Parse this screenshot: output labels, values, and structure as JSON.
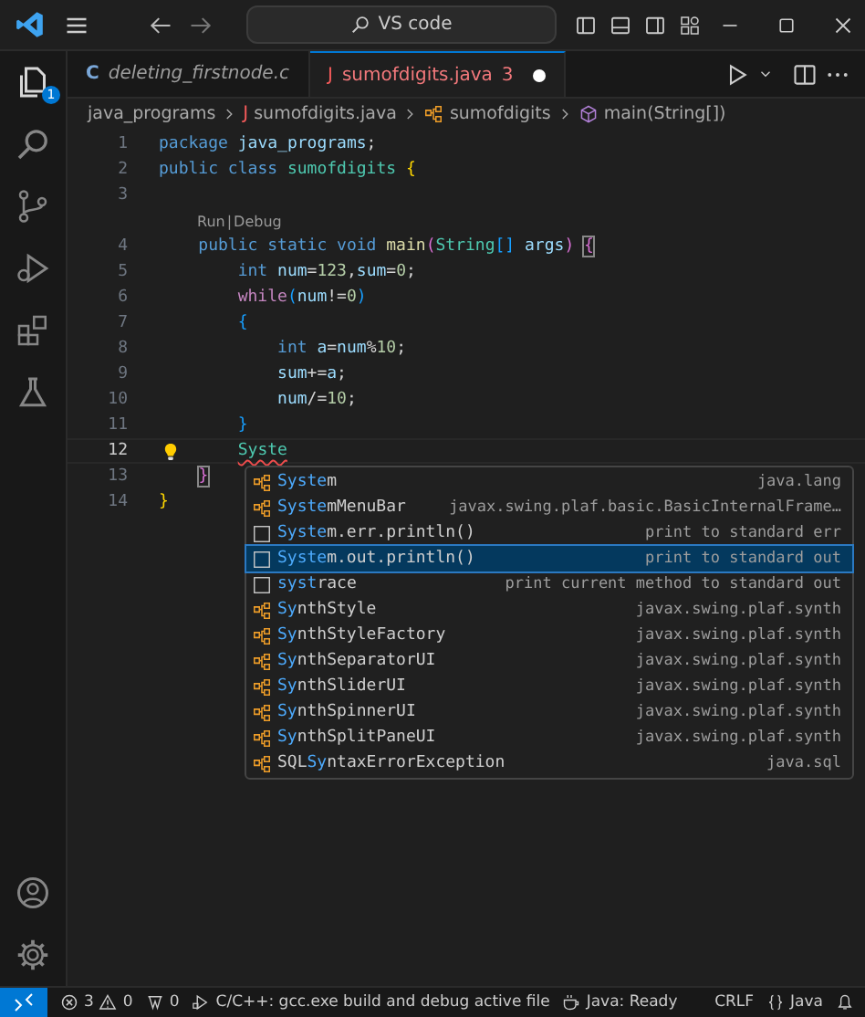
{
  "title_bar": {
    "search": "VS code"
  },
  "activity_bar": {
    "items": [
      {
        "kind": "explorer",
        "selected": true,
        "badge": "1"
      },
      {
        "kind": "search",
        "selected": false
      },
      {
        "kind": "source-control",
        "selected": false
      },
      {
        "kind": "run-debug",
        "selected": false
      },
      {
        "kind": "extensions",
        "selected": false
      },
      {
        "kind": "testing",
        "selected": false
      }
    ],
    "bottom": [
      {
        "kind": "account"
      },
      {
        "kind": "settings"
      }
    ]
  },
  "tabs": [
    {
      "kind": "c",
      "icon": "C",
      "label": "deleting_firstnode.c",
      "selected": false,
      "italic": true
    },
    {
      "kind": "java",
      "icon": "J",
      "label": "sumofdigits.java",
      "problems": "3",
      "dirty": true,
      "selected": true,
      "italic": false
    }
  ],
  "breadcrumb": [
    {
      "kind": "folder",
      "label": "java_programs"
    },
    {
      "kind": "java-file",
      "icon": "J",
      "label": "sumofdigits.java"
    },
    {
      "kind": "class",
      "label": "sumofdigits"
    },
    {
      "kind": "method",
      "label": "main(String[])"
    }
  ],
  "code_lines": [
    {
      "number": "1",
      "current": false,
      "tokens": [
        {
          "kind": "keyword",
          "text": "package"
        },
        {
          "kind": "ident",
          "text": " java_programs"
        },
        {
          "kind": "plain",
          "text": ";"
        }
      ]
    },
    {
      "number": "2",
      "current": false,
      "tokens": [
        {
          "kind": "keyword",
          "text": "public"
        },
        {
          "kind": "keyword",
          "text": " class"
        },
        {
          "kind": "type",
          "text": " sumofdigits"
        },
        {
          "kind": "bracket1",
          "text": " {"
        }
      ]
    },
    {
      "number": "3",
      "current": false
    },
    {
      "kind": "codelens",
      "links": [
        "Run",
        "Debug"
      ],
      "separator": "|"
    },
    {
      "number": "4",
      "current": false,
      "tokens": [
        {
          "kind": "keyword",
          "text": "    public"
        },
        {
          "kind": "keyword",
          "text": " static"
        },
        {
          "kind": "keyword",
          "text": " void"
        },
        {
          "kind": "function",
          "text": " main"
        },
        {
          "kind": "bracket2",
          "text": "("
        },
        {
          "kind": "type",
          "text": "String"
        },
        {
          "kind": "bracket3",
          "text": "[]"
        },
        {
          "kind": "ident",
          "text": " args"
        },
        {
          "kind": "bracket2",
          "text": ") "
        },
        {
          "kind": "bracket-match",
          "text": "{"
        }
      ]
    },
    {
      "number": "5",
      "current": false,
      "tokens": [
        {
          "kind": "keyword",
          "text": "        int"
        },
        {
          "kind": "ident",
          "text": " num"
        },
        {
          "kind": "plain",
          "text": "="
        },
        {
          "kind": "number",
          "text": "123"
        },
        {
          "kind": "plain",
          "text": ","
        },
        {
          "kind": "ident",
          "text": "sum"
        },
        {
          "kind": "plain",
          "text": "="
        },
        {
          "kind": "number",
          "text": "0"
        },
        {
          "kind": "plain",
          "text": ";"
        }
      ]
    },
    {
      "number": "6",
      "current": false,
      "tokens": [
        {
          "kind": "control",
          "text": "        while"
        },
        {
          "kind": "bracket3",
          "text": "("
        },
        {
          "kind": "ident",
          "text": "num"
        },
        {
          "kind": "plain",
          "text": "!="
        },
        {
          "kind": "number",
          "text": "0"
        },
        {
          "kind": "bracket3",
          "text": ")"
        }
      ]
    },
    {
      "number": "7",
      "current": false,
      "tokens": [
        {
          "kind": "bracket3",
          "text": "        {"
        }
      ]
    },
    {
      "number": "8",
      "current": false,
      "tokens": [
        {
          "kind": "keyword",
          "text": "            int"
        },
        {
          "kind": "ident",
          "text": " a"
        },
        {
          "kind": "plain",
          "text": "="
        },
        {
          "kind": "ident",
          "text": "num"
        },
        {
          "kind": "plain",
          "text": "%"
        },
        {
          "kind": "number",
          "text": "10"
        },
        {
          "kind": "plain",
          "text": ";"
        }
      ]
    },
    {
      "number": "9",
      "current": false,
      "tokens": [
        {
          "kind": "ident",
          "text": "            sum"
        },
        {
          "kind": "plain",
          "text": "+="
        },
        {
          "kind": "ident",
          "text": "a"
        },
        {
          "kind": "plain",
          "text": ";"
        }
      ]
    },
    {
      "number": "10",
      "current": false,
      "tokens": [
        {
          "kind": "ident",
          "text": "            num"
        },
        {
          "kind": "plain",
          "text": "/="
        },
        {
          "kind": "number",
          "text": "10"
        },
        {
          "kind": "plain",
          "text": ";"
        }
      ]
    },
    {
      "number": "11",
      "current": false,
      "tokens": [
        {
          "kind": "bracket3",
          "text": "        }"
        }
      ]
    },
    {
      "number": "12",
      "current": true,
      "lightbulb": true,
      "tokens": [
        {
          "kind": "error",
          "text": "        Syste"
        }
      ]
    },
    {
      "number": "13",
      "current": false,
      "tokens": [
        {
          "kind": "bracket-match",
          "text": "    }"
        }
      ]
    },
    {
      "number": "14",
      "current": false,
      "tokens": [
        {
          "kind": "bracket1",
          "text": "}"
        }
      ]
    }
  ],
  "suggestions": [
    {
      "kind": "class",
      "label": "**Syste**m",
      "detail": "java.lang",
      "selected": false
    },
    {
      "kind": "class",
      "label": "**Syste**mMenuBar",
      "detail": "javax.swing.plaf.basic.BasicInternalFrame…",
      "selected": false
    },
    {
      "kind": "snippet",
      "label": "**Syste**m.err.println()",
      "detail": "print to standard err",
      "selected": false
    },
    {
      "kind": "snippet",
      "label": "**Syste**m.out.println()",
      "detail": "print to standard out",
      "selected": true
    },
    {
      "kind": "snippet",
      "label": "**syst**race",
      "detail": "print current method to standard out",
      "selected": false
    },
    {
      "kind": "class",
      "label": "**Sy**nthStyle",
      "detail": "javax.swing.plaf.synth",
      "selected": false
    },
    {
      "kind": "class",
      "label": "**Sy**nthStyleFactory",
      "detail": "javax.swing.plaf.synth",
      "selected": false
    },
    {
      "kind": "class",
      "label": "**Sy**nthSeparatorUI",
      "detail": "javax.swing.plaf.synth",
      "selected": false
    },
    {
      "kind": "class",
      "label": "**Sy**nthSliderUI",
      "detail": "javax.swing.plaf.synth",
      "selected": false
    },
    {
      "kind": "class",
      "label": "**Sy**nthSpinnerUI",
      "detail": "javax.swing.plaf.synth",
      "selected": false
    },
    {
      "kind": "class",
      "label": "**Sy**nthSplitPaneUI",
      "detail": "javax.swing.plaf.synth",
      "selected": false
    },
    {
      "kind": "class",
      "label": "SQL**Sy**ntaxErrorException",
      "detail": "java.sql",
      "selected": false
    }
  ],
  "status_bar": [
    {
      "kind": "remote"
    },
    {
      "kind": "problems",
      "errors": "3",
      "warnings": "0"
    },
    {
      "kind": "ports",
      "text": "0"
    },
    {
      "kind": "task",
      "text": "C/C++: gcc.exe build and debug active file"
    },
    {
      "kind": "java",
      "text": "Java: Ready"
    },
    {
      "kind": "spacer"
    },
    {
      "kind": "plain",
      "text": "CRLF"
    },
    {
      "kind": "language",
      "text": "Java"
    },
    {
      "kind": "bell"
    }
  ]
}
